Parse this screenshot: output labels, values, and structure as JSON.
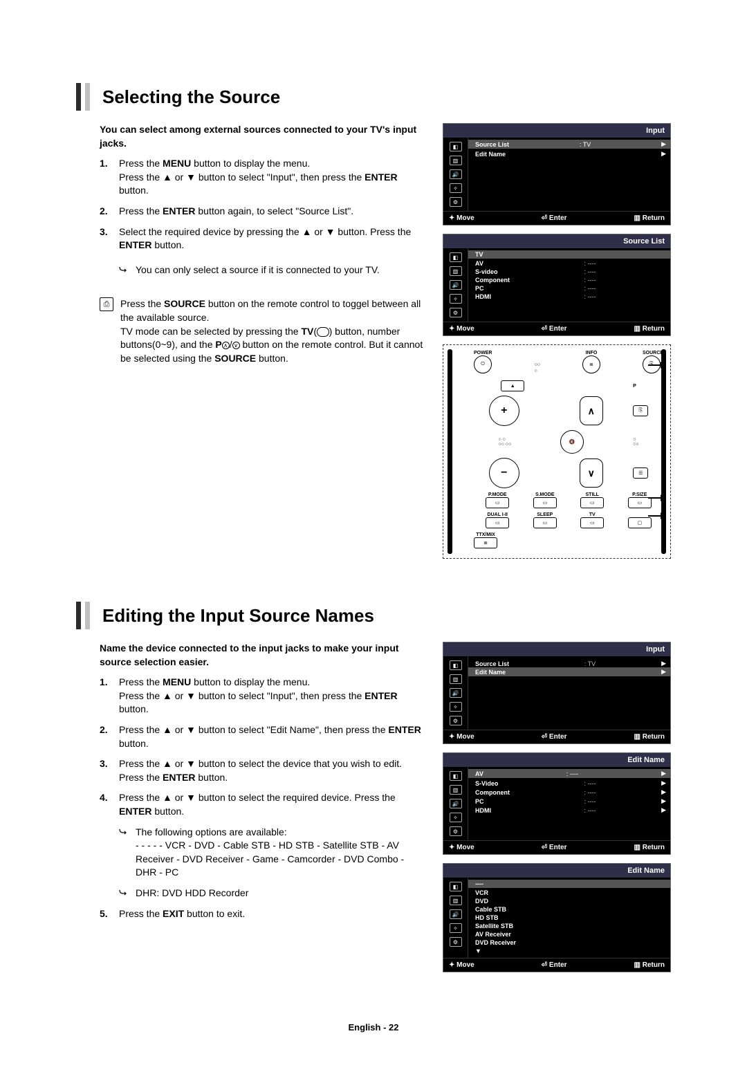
{
  "sections": [
    {
      "title": "Selecting the Source",
      "intro": "You can select among external sources connected to your TV's input jacks.",
      "steps": [
        {
          "num": "1.",
          "html": [
            "Press the ",
            {
              "b": "MENU"
            },
            " button to display the menu.\nPress the ▲ or ▼ button to select \"Input\", then press the ",
            {
              "b": "ENTER"
            },
            " button."
          ]
        },
        {
          "num": "2.",
          "html": [
            "Press the ",
            {
              "b": "ENTER"
            },
            " button again, to select \"Source List\"."
          ]
        },
        {
          "num": "3.",
          "html": [
            "Select the required device by pressing the ▲ or ▼ button. Press the ",
            {
              "b": "ENTER"
            },
            " button."
          ]
        }
      ],
      "step_note": "You can only select a source if it is connected to your TV.",
      "tip": [
        "Press the ",
        {
          "b": "SOURCE"
        },
        " button on the remote control to toggel between all the available source.\nTV mode can be selected by pressing the ",
        {
          "b": "TV"
        },
        "(",
        {
          "pill": ""
        },
        ") button, number buttons(0~9), and the ",
        {
          "b": "P"
        },
        {
          "circ": "∧"
        },
        "/",
        {
          "circ": "∨"
        },
        " button on the remote control. But it cannot be selected using the ",
        {
          "b": "SOURCE"
        },
        " button."
      ],
      "osd_panels": [
        {
          "title": "Input",
          "rows": [
            {
              "label": "Source List",
              "value": ": TV",
              "arrow": "▶",
              "sel": true
            },
            {
              "label": "Edit Name",
              "value": "",
              "arrow": "▶"
            }
          ],
          "foot": [
            "✦ Move",
            "⏎ Enter",
            "▥ Return"
          ]
        },
        {
          "title": "Source List",
          "rows": [
            {
              "label": "TV",
              "value": "",
              "arrow": "",
              "sel": true
            },
            {
              "label": "AV",
              "value": ": ----",
              "arrow": ""
            },
            {
              "label": "S-video",
              "value": ": ----",
              "arrow": ""
            },
            {
              "label": "Component",
              "value": ": ----",
              "arrow": ""
            },
            {
              "label": "PC",
              "value": ": ----",
              "arrow": ""
            },
            {
              "label": "HDMI",
              "value": ": ----",
              "arrow": ""
            }
          ],
          "foot": [
            "✦ Move",
            "⏎ Enter",
            "▥ Return"
          ]
        }
      ],
      "remote": {
        "top_labels": [
          "POWER",
          "INFO",
          "SOURCE"
        ],
        "mid_labels": [
          "P.MODE",
          "S.MODE",
          "STILL",
          "P.SIZE",
          "DUAL I-II",
          "SLEEP",
          "TV",
          "TTX/MIX"
        ]
      }
    },
    {
      "title": "Editing the Input Source Names",
      "intro": "Name the device connected to the input jacks to make your input source selection easier.",
      "steps": [
        {
          "num": "1.",
          "html": [
            "Press the ",
            {
              "b": "MENU"
            },
            " button to display the menu.\nPress the ▲ or ▼ button to select \"Input\", then press the ",
            {
              "b": "ENTER"
            },
            " button."
          ]
        },
        {
          "num": "2.",
          "html": [
            "Press the ▲ or ▼ button to select \"Edit Name\", then press the ",
            {
              "b": "ENTER"
            },
            " button."
          ]
        },
        {
          "num": "3.",
          "html": [
            "Press the ▲ or ▼ button to select the device that you wish to edit. Press the ",
            {
              "b": "ENTER"
            },
            " button."
          ]
        },
        {
          "num": "4.",
          "html": [
            "Press the ▲ or ▼ button to select the required device. Press the ",
            {
              "b": "ENTER"
            },
            " button."
          ],
          "subnotes": [
            "The following options are available:\n- - - - - VCR - DVD - Cable STB - HD STB - Satellite STB - AV Receiver - DVD Receiver - Game - Camcorder - DVD Combo - DHR - PC",
            "DHR: DVD HDD Recorder"
          ]
        },
        {
          "num": "5.",
          "html": [
            "Press the ",
            {
              "b": "EXIT"
            },
            " button to exit."
          ]
        }
      ],
      "osd_panels": [
        {
          "title": "Input",
          "rows": [
            {
              "label": "Source List",
              "value": ": TV",
              "arrow": "▶"
            },
            {
              "label": "Edit Name",
              "value": "",
              "arrow": "▶",
              "sel": true
            }
          ],
          "foot": [
            "✦ Move",
            "⏎ Enter",
            "▥ Return"
          ]
        },
        {
          "title": "Edit Name",
          "rows": [
            {
              "label": "AV",
              "value": ": ----",
              "arrow": "▶",
              "sel": true
            },
            {
              "label": "S-Video",
              "value": ": ----",
              "arrow": "▶"
            },
            {
              "label": "Component",
              "value": ": ----",
              "arrow": "▶"
            },
            {
              "label": "PC",
              "value": ": ----",
              "arrow": "▶"
            },
            {
              "label": "HDMI",
              "value": ": ----",
              "arrow": "▶"
            }
          ],
          "foot": [
            "✦ Move",
            "⏎ Enter",
            "▥ Return"
          ]
        },
        {
          "title": "Edit Name",
          "rows": [
            {
              "label": "----",
              "value": "",
              "arrow": "",
              "sel": true
            },
            {
              "label": "VCR",
              "value": "",
              "arrow": ""
            },
            {
              "label": "DVD",
              "value": "",
              "arrow": ""
            },
            {
              "label": "Cable STB",
              "value": "",
              "arrow": ""
            },
            {
              "label": "HD STB",
              "value": "",
              "arrow": ""
            },
            {
              "label": "Satellite STB",
              "value": "",
              "arrow": ""
            },
            {
              "label": "AV Receiver",
              "value": "",
              "arrow": ""
            },
            {
              "label": "DVD Receiver",
              "value": "",
              "arrow": ""
            }
          ],
          "foot": [
            "✦ Move",
            "⏎ Enter",
            "▥ Return"
          ],
          "more": "▼"
        }
      ]
    }
  ],
  "footer": "English - 22",
  "icons": {
    "remote_tip": "⎙",
    "power": "⏻",
    "info": "≣",
    "source": "⎘",
    "plus": "+",
    "minus": "−",
    "up": "∧",
    "down": "∨",
    "mute": "✕"
  }
}
